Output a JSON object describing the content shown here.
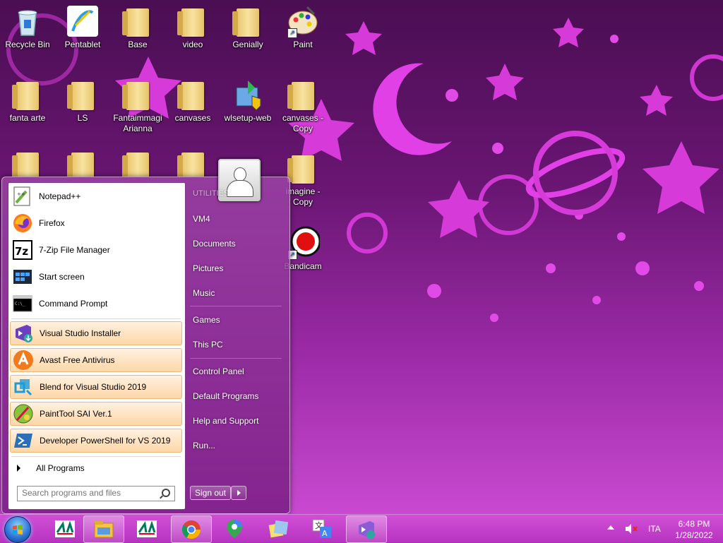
{
  "desktop": {
    "icons": [
      {
        "label": "Recycle Bin"
      },
      {
        "label": "Pentablet"
      },
      {
        "label": "Base"
      },
      {
        "label": "video"
      },
      {
        "label": "Genially"
      },
      {
        "label": "Paint"
      },
      {
        "label": "fanta arte"
      },
      {
        "label": "LS"
      },
      {
        "label": "Fantaimmagi Arianna"
      },
      {
        "label": "canvases"
      },
      {
        "label": "wlsetup-web"
      },
      {
        "label": "canvases - Copy"
      },
      {
        "label": "imagine - Copy"
      },
      {
        "label": "Bandicam"
      }
    ]
  },
  "start_menu": {
    "programs": [
      {
        "label": "Notepad++"
      },
      {
        "label": "Firefox"
      },
      {
        "label": "7-Zip File Manager"
      },
      {
        "label": "Start screen"
      },
      {
        "label": "Command Prompt"
      }
    ],
    "pinned": [
      {
        "label": "Visual Studio Installer"
      },
      {
        "label": "Avast Free Antivirus"
      },
      {
        "label": "Blend for Visual Studio 2019"
      },
      {
        "label": "PaintTool SAI Ver.1"
      },
      {
        "label": "Developer PowerShell for VS 2019"
      }
    ],
    "all_programs": "All Programs",
    "search_placeholder": "Search programs and files",
    "right": {
      "utilities": "UTILITIES",
      "items": [
        "VM4",
        "Documents",
        "Pictures",
        "Music",
        "Games",
        "This PC",
        "Control Panel",
        "Default Programs",
        "Help and Support",
        "Run..."
      ]
    },
    "sign_out": "Sign out"
  },
  "taskbar": {
    "lang": "ITA",
    "time": "6:48 PM",
    "date": "1/28/2022"
  }
}
